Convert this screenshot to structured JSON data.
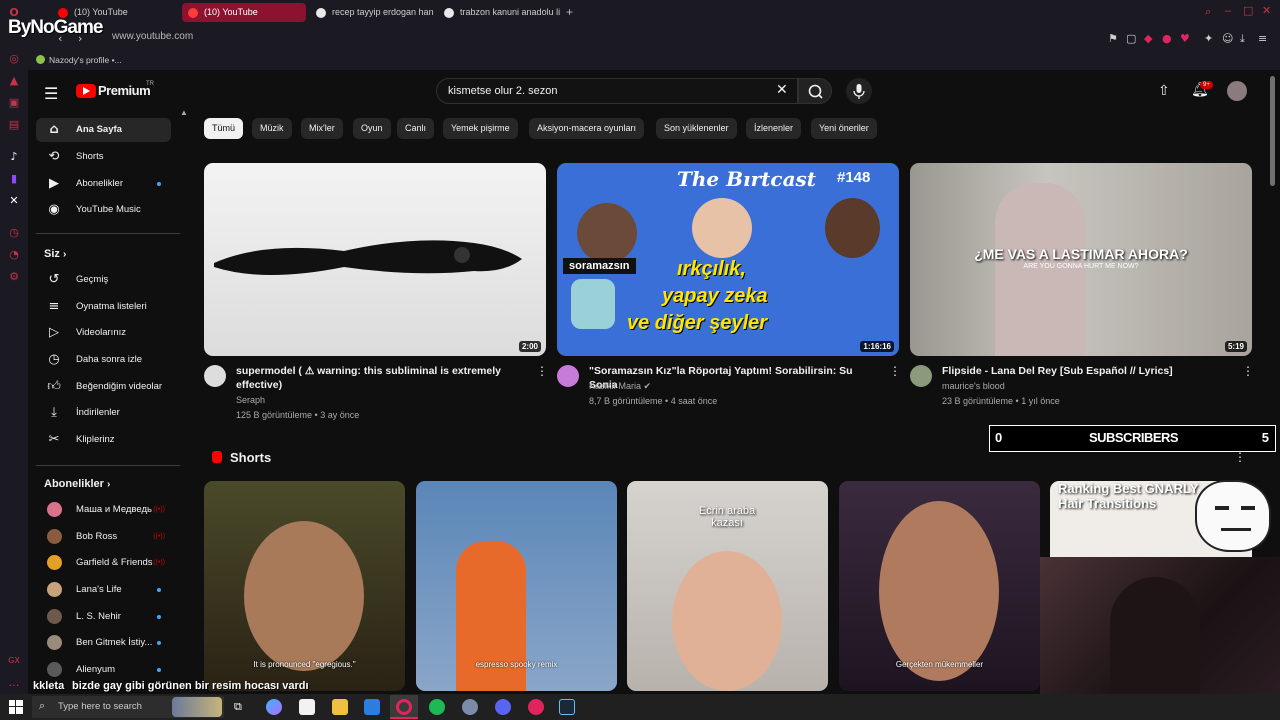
{
  "browser": {
    "tabs": [
      {
        "label": "(10) YouTube"
      },
      {
        "label": "(10) YouTube"
      },
      {
        "label": "recep tayyip erdogan han"
      },
      {
        "label": "trabzon kanuni anadolu li"
      }
    ],
    "new_tab": "+",
    "address": "www.youtube.com",
    "profile_label": "Nazody's profile •..."
  },
  "overlay": {
    "logo": "ByNoGame",
    "subscribers_left": "0",
    "subscribers_label": "SUBSCRIBERS",
    "subscribers_right": "5",
    "chat_user": "kkleta",
    "chat_message": "bizde gay gibi görünen bir resim hocası vardı"
  },
  "youtube": {
    "logo": "Premium",
    "logo_region": "TR",
    "search_value": "kismetse olur 2. sezon",
    "notif_badge": "9+",
    "chips": [
      "Tümü",
      "Müzik",
      "Mix'ler",
      "Oyun",
      "Canlı",
      "Yemek pişirme",
      "Aksiyon-macera oyunları",
      "Son yüklenenler",
      "İzlenenler",
      "Yeni öneriler"
    ],
    "sidebar": {
      "main": [
        {
          "label": "Ana Sayfa",
          "icon": "home-icon"
        },
        {
          "label": "Shorts",
          "icon": "shorts-icon"
        },
        {
          "label": "Abonelikler",
          "icon": "subscriptions-icon"
        },
        {
          "label": "YouTube Music",
          "icon": "music-icon"
        }
      ],
      "you_header": "Siz",
      "you": [
        {
          "label": "Geçmiş",
          "icon": "history-icon"
        },
        {
          "label": "Oynatma listeleri",
          "icon": "playlist-icon"
        },
        {
          "label": "Videolarınız",
          "icon": "video-icon"
        },
        {
          "label": "Daha sonra izle",
          "icon": "clock-icon"
        },
        {
          "label": "Beğendiğim videolar",
          "icon": "like-icon"
        },
        {
          "label": "İndirilenler",
          "icon": "download-icon"
        },
        {
          "label": "Kliplerinz",
          "icon": "scissors-icon"
        }
      ],
      "subs_header": "Abonelikler",
      "subs": [
        {
          "label": "Маша и Медведь",
          "color": "#d9738a"
        },
        {
          "label": "Bob Ross",
          "color": "#8a5b3c"
        },
        {
          "label": "Garfield & Friends",
          "color": "#e3a027"
        },
        {
          "label": "Lana's Life",
          "color": "#c9a27c"
        },
        {
          "label": "L. S. Nehir",
          "color": "#6d5a4c"
        },
        {
          "label": "Ben Gitmek İstiy...",
          "color": "#9b8b7a"
        },
        {
          "label": "Alienyum",
          "color": "#5a5a5a"
        }
      ]
    },
    "videos": [
      {
        "title": "supermodel ( ⚠ warning: this subliminal is extremely effective)",
        "channel": "Seraph",
        "meta": "125 B görüntüleme • 3 ay önce",
        "duration": "2:00"
      },
      {
        "title": "\"Soramazsın Kız\"la Röportaj Yaptım! Sorabilirsin: Su Sonia",
        "channel": "Kazıklı Maria ✔",
        "meta": "8,7 B görüntüleme • 4 saat önce",
        "duration": "1:16:16",
        "thumb_title": "The Bırtcast",
        "thumb_ep": "#148",
        "thumb_tag": "soramazsın",
        "thumb_text": [
          "ırkçılık,",
          "yapay zeka",
          "ve diğer şeyler"
        ]
      },
      {
        "title": "Flipside - Lana Del Rey [Sub Español // Lyrics]",
        "channel": "maurice's blood",
        "meta": "23 B görüntüleme • 1 yıl önce",
        "duration": "5:19",
        "thumb_text": "¿ME VAS A LASTIMAR AHORA?",
        "thumb_sub": "ARE YOU GONNA HURT ME NOW?"
      }
    ],
    "shorts_header": "Shorts",
    "shorts": [
      {
        "caption": "It is pronounced \"egregious.\""
      },
      {
        "caption": "espresso spooky remix"
      },
      {
        "caption": "Ecrin araba kazası"
      },
      {
        "caption": "Gerçekten mükemmeller"
      },
      {
        "caption": "Ranking Best GNARLY Hair Transitions"
      }
    ]
  },
  "taskbar": {
    "search_placeholder": "Type here to search"
  }
}
